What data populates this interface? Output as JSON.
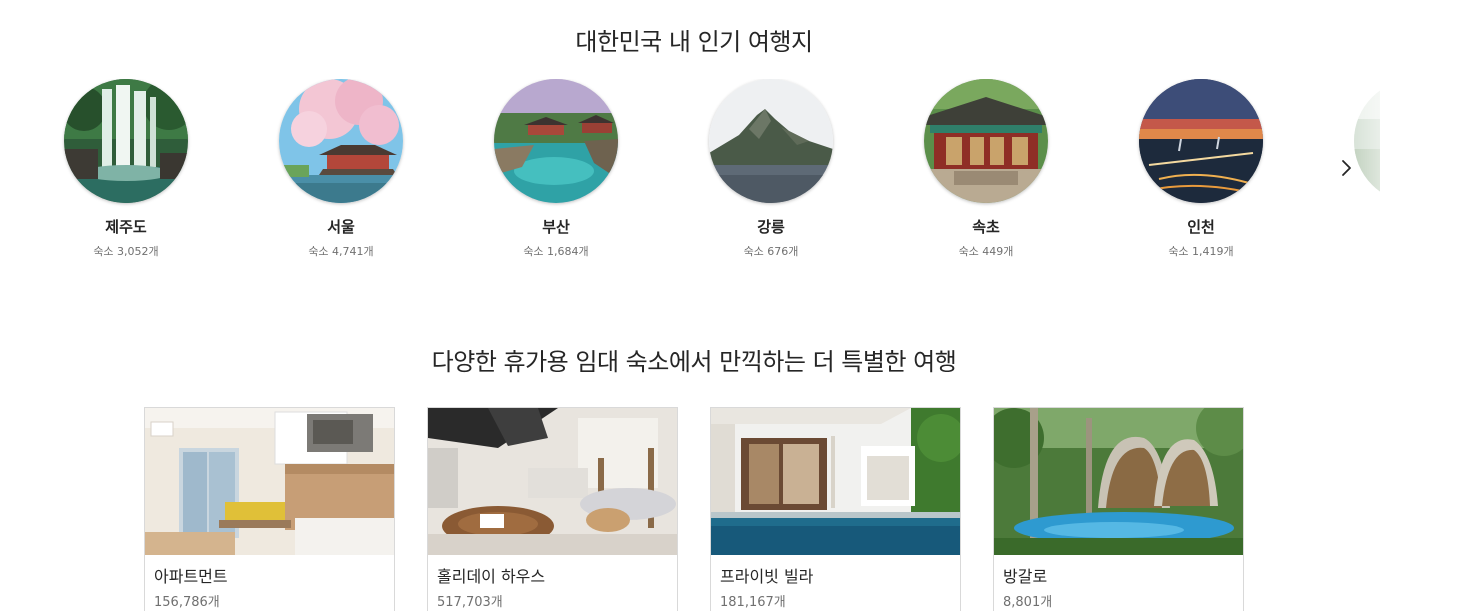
{
  "destinations_section": {
    "title": "대한민국 내 인기 여행지",
    "items": [
      {
        "name": "제주도",
        "count": "숙소 3,052개",
        "icon": "waterfall-photo"
      },
      {
        "name": "서울",
        "count": "숙소 4,741개",
        "icon": "palace-cherry-blossom-photo"
      },
      {
        "name": "부산",
        "count": "숙소 1,684개",
        "icon": "seaside-temple-photo"
      },
      {
        "name": "강릉",
        "count": "숙소 676개",
        "icon": "rocky-island-photo"
      },
      {
        "name": "속초",
        "count": "숙소 449개",
        "icon": "temple-photo"
      },
      {
        "name": "인천",
        "count": "숙소 1,419개",
        "icon": "bridge-sunset-photo"
      }
    ],
    "next_icon": "chevron-right-icon"
  },
  "property_types_section": {
    "title": "다양한 휴가용 임대 숙소에서 만끽하는 더 특별한 여행",
    "items": [
      {
        "name": "아파트먼트",
        "count": "156,786개",
        "icon": "apartment-photo"
      },
      {
        "name": "홀리데이 하우스",
        "count": "517,703개",
        "icon": "holiday-house-photo"
      },
      {
        "name": "프라이빗 빌라",
        "count": "181,167개",
        "icon": "private-villa-photo"
      },
      {
        "name": "방갈로",
        "count": "8,801개",
        "icon": "bungalow-photo"
      }
    ]
  },
  "colors": {
    "text_primary": "#262626",
    "text_secondary": "#707070",
    "card_border": "#d9d9d9"
  }
}
